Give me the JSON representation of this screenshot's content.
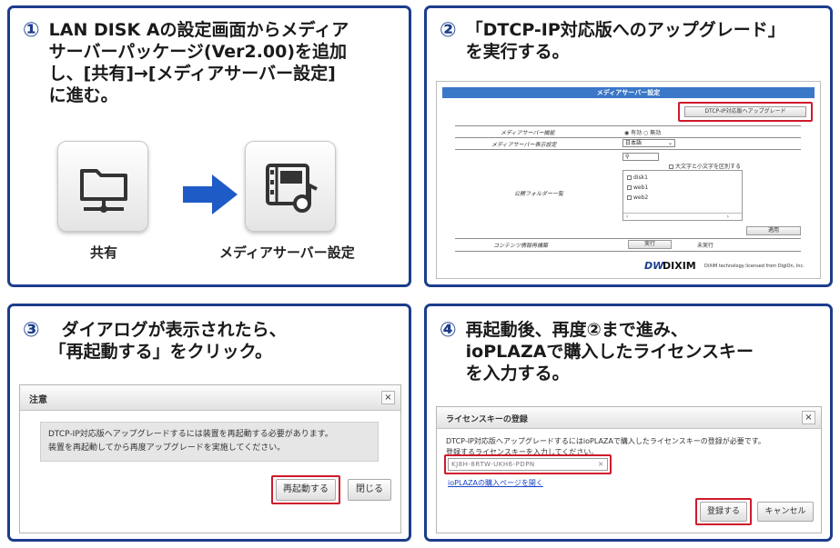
{
  "panel1": {
    "number": "①",
    "lines": [
      "LAN DISK Aの設定画面からメディア",
      "サーバーパッケージ(Ver2.00)を追加",
      "し、[共有]→[メディアサーバー設定]",
      "に進む。"
    ],
    "icon_share_label": "共有",
    "icon_media_label": "メディアサーバー設定"
  },
  "panel2": {
    "number": "②",
    "lines": [
      "「DTCP-IP対応版へのアップグレード」",
      "を実行する。"
    ],
    "shot": {
      "title": "メディアサーバー設定",
      "upgrade_button": "DTCP-IP対応版へアップグレード",
      "row1_label": "メディアサーバー機能",
      "row1_value": "◉ 有効 ○ 無効",
      "row2_label": "メディアサーバー表示設定",
      "row2_value": "日本語",
      "case_option": "大文字と小文字を区別する",
      "folder_label": "公開フォルダー一覧",
      "folders": [
        "disk1",
        "web1",
        "web2"
      ],
      "apply_button": "適用",
      "row4_label": "コンテンツ情報再構築",
      "run_button": "実行",
      "row4_status": "未実行",
      "logo": "DIXIM",
      "logo_mark": "DW",
      "credit": "DiXiM technology licensed from DigiOn, Inc."
    }
  },
  "panel3": {
    "number": "③",
    "lines": [
      "ダイアログが表示されたら、",
      "「再起動する」をクリック。"
    ],
    "dialog": {
      "title": "注意",
      "close": "×",
      "message_lines": [
        "DTCP-IP対応版へアップグレードするには装置を再起動する必要があります。",
        "装置を再起動してから再度アップグレードを実施してください。"
      ],
      "restart_button": "再起動する",
      "close_button": "閉じる"
    }
  },
  "panel4": {
    "number": "④",
    "lines": [
      "再起動後、再度②まで進み、",
      "ioPLAZAで購入したライセンスキー",
      "を入力する。"
    ],
    "dialog": {
      "title": "ライセンスキーの登録",
      "close": "×",
      "message_lines": [
        "DTCP-IP対応版へアップグレードするにはioPLAZAで購入したライセンスキーの登録が必要です。",
        "登録するライセンスキーを入力してください。"
      ],
      "input_value": "KJ8H-8RTW-UKH6-PDPN",
      "input_clear": "×",
      "link": "ioPLAZAの購入ページを開く",
      "register_button": "登録する",
      "cancel_button": "キャンセル"
    }
  },
  "colors": {
    "border": "#1c3d8c",
    "highlight": "#d0192c",
    "arrow": "#1e5bc6"
  }
}
